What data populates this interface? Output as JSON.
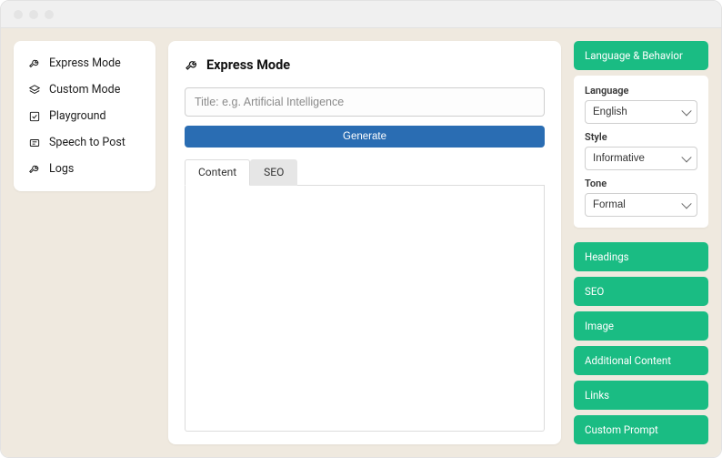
{
  "colors": {
    "accent": "#1abc83",
    "primary_btn": "#2a6db3"
  },
  "sidebar": {
    "items": [
      {
        "label": "Express Mode"
      },
      {
        "label": "Custom Mode"
      },
      {
        "label": "Playground"
      },
      {
        "label": "Speech to Post"
      },
      {
        "label": "Logs"
      }
    ]
  },
  "main": {
    "title": "Express Mode",
    "title_input_value": "",
    "title_input_placeholder": "Title: e.g. Artificial Intelligence",
    "generate_label": "Generate",
    "tabs": [
      {
        "label": "Content",
        "active": true
      },
      {
        "label": "SEO",
        "active": false
      }
    ],
    "content_value": ""
  },
  "settings": {
    "expanded_panel": "Language & Behavior",
    "language": {
      "label": "Language",
      "value": "English"
    },
    "style": {
      "label": "Style",
      "value": "Informative"
    },
    "tone": {
      "label": "Tone",
      "value": "Formal"
    },
    "collapsed_panels": [
      "Headings",
      "SEO",
      "Image",
      "Additional Content",
      "Links",
      "Custom Prompt"
    ]
  }
}
